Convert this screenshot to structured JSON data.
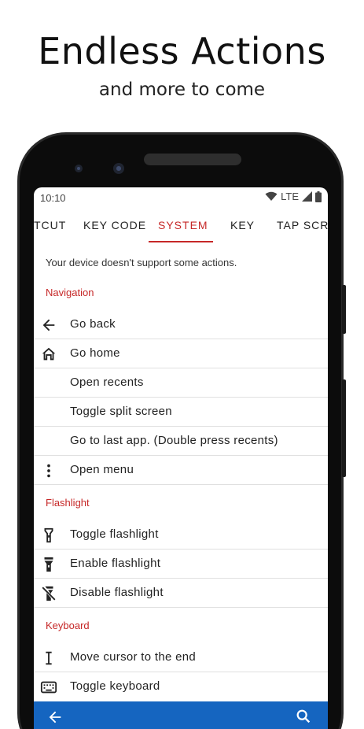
{
  "headline": "Endless Actions",
  "subheadline": "and more to come",
  "status_bar": {
    "time": "10:10",
    "network": "LTE"
  },
  "tabs": [
    "TCUT",
    "KEY CODE",
    "SYSTEM",
    "KEY",
    "TAP SCRE"
  ],
  "active_tab": "SYSTEM",
  "notice": "Your device doesn't support some actions.",
  "sections": {
    "navigation": {
      "title": "Navigation",
      "items": [
        {
          "label": "Go back",
          "icon": "arrow-back-icon"
        },
        {
          "label": "Go home",
          "icon": "home-icon"
        },
        {
          "label": "Open recents",
          "icon": ""
        },
        {
          "label": "Toggle split screen",
          "icon": ""
        },
        {
          "label": "Go to last app. (Double press recents)",
          "icon": ""
        },
        {
          "label": "Open menu",
          "icon": "more-vert-icon"
        }
      ]
    },
    "flashlight": {
      "title": "Flashlight",
      "items": [
        {
          "label": "Toggle flashlight",
          "icon": "flashlight-icon"
        },
        {
          "label": "Enable flashlight",
          "icon": "flashlight-on-icon"
        },
        {
          "label": "Disable flashlight",
          "icon": "flashlight-off-icon"
        }
      ]
    },
    "keyboard": {
      "title": "Keyboard",
      "items": [
        {
          "label": "Move cursor to the end",
          "icon": "text-cursor-icon"
        },
        {
          "label": "Toggle keyboard",
          "icon": "keyboard-icon"
        }
      ]
    }
  },
  "colors": {
    "accent": "#c62828",
    "app_bar": "#1565c0",
    "divider": "#e0e0e0"
  }
}
